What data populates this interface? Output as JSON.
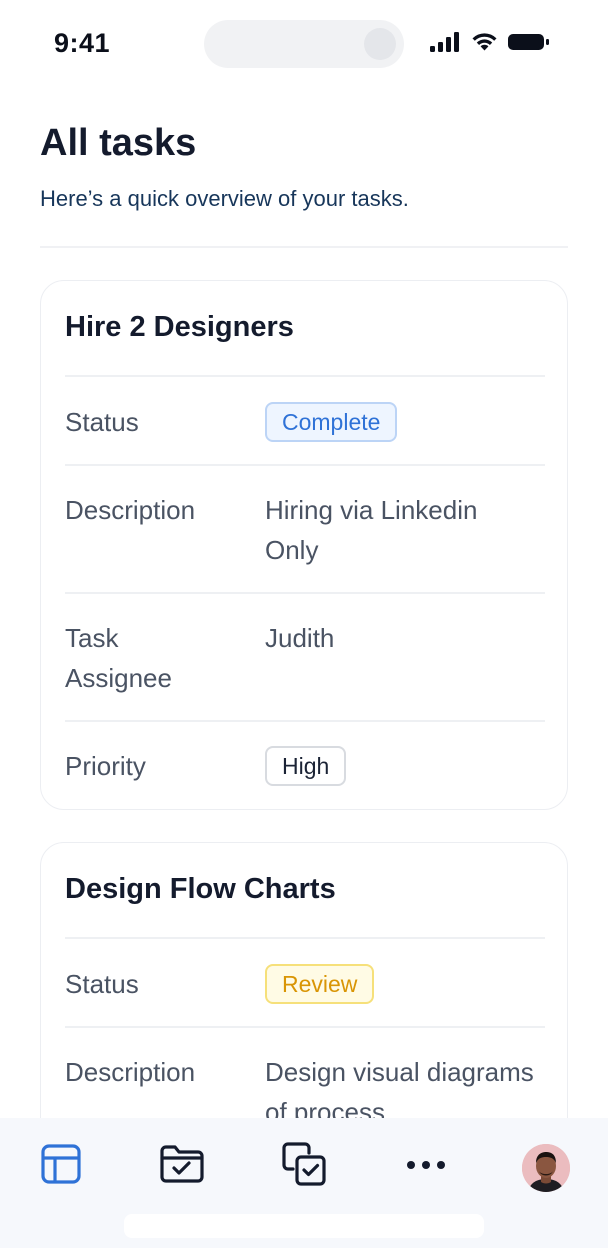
{
  "status_bar": {
    "time": "9:41",
    "icons": [
      "cellular-signal-icon",
      "wifi-icon",
      "battery-icon"
    ]
  },
  "header": {
    "title": "All tasks",
    "subtitle": "Here’s a quick overview of your tasks."
  },
  "tasks": [
    {
      "title": "Hire 2 Designers",
      "status_label": "Status",
      "status": "Complete",
      "description_label": "Description",
      "description": "Hiring via Linkedin Only",
      "assignee_label": "Task Assignee",
      "assignee": "Judith",
      "priority_label": "Priority",
      "priority": "High"
    },
    {
      "title": "Design Flow Charts",
      "status_label": "Status",
      "status": "Review",
      "description_label": "Description",
      "description": "Design visual diagrams of process"
    }
  ],
  "bottom_nav": {
    "items": [
      "layout-icon",
      "folder-check-icon",
      "copy-check-icon",
      "more-icon",
      "avatar"
    ],
    "active_color": "#2f72d7",
    "inactive_color": "#141b2d"
  },
  "colors": {
    "complete": "#2f72d7",
    "review": "#d99505",
    "title": "#141b2d"
  }
}
